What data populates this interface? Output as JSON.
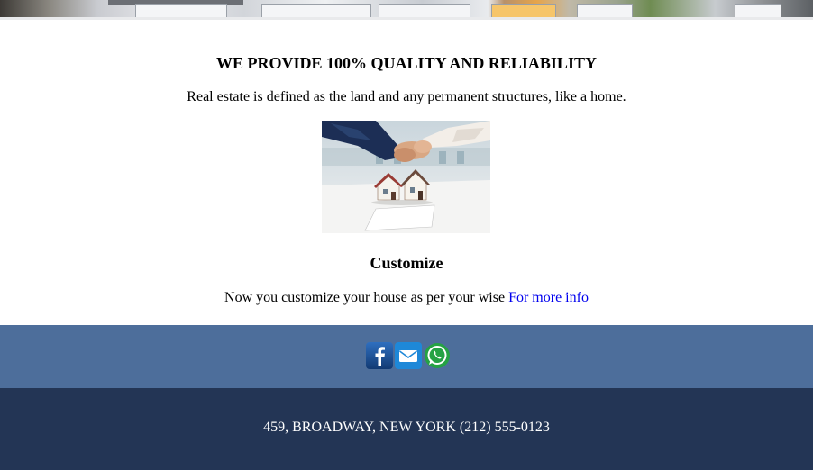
{
  "content": {
    "heading": "WE PROVIDE 100% QUALITY AND RELIABILITY",
    "subheading": "Real estate is defined as the land and any permanent structures, like a home.",
    "customize_title": "Customize",
    "customize_text": "Now you customize your house as per your wise",
    "more_info_link": "For more info"
  },
  "social": {
    "icons": [
      "facebook-icon",
      "email-icon",
      "whatsapp-icon"
    ]
  },
  "footer": {
    "address": "459, BROADWAY, NEW YORK (212) 555-0123"
  },
  "colors": {
    "social_band": "#4d6e9b",
    "footer_bg": "#233555",
    "link": "#0000ee"
  }
}
